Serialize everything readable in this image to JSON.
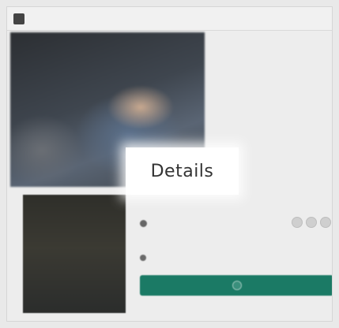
{
  "header": {
    "title": "",
    "tabs": [
      "",
      "",
      ""
    ],
    "right": ""
  },
  "article": {
    "headline": "",
    "body": "",
    "note": ""
  },
  "poster": {
    "title": ""
  },
  "section": {
    "heading": "",
    "heading_right": ""
  },
  "row1": {
    "label": "",
    "controls": [
      "",
      "",
      ""
    ]
  },
  "row2": {
    "label": "",
    "right": ""
  },
  "footer": {
    "text": ""
  },
  "popup": {
    "label": "Details"
  },
  "colors": {
    "accent_green": "#1b7a65",
    "popup_bg": "#ffffff",
    "page_bg": "#ededed"
  }
}
